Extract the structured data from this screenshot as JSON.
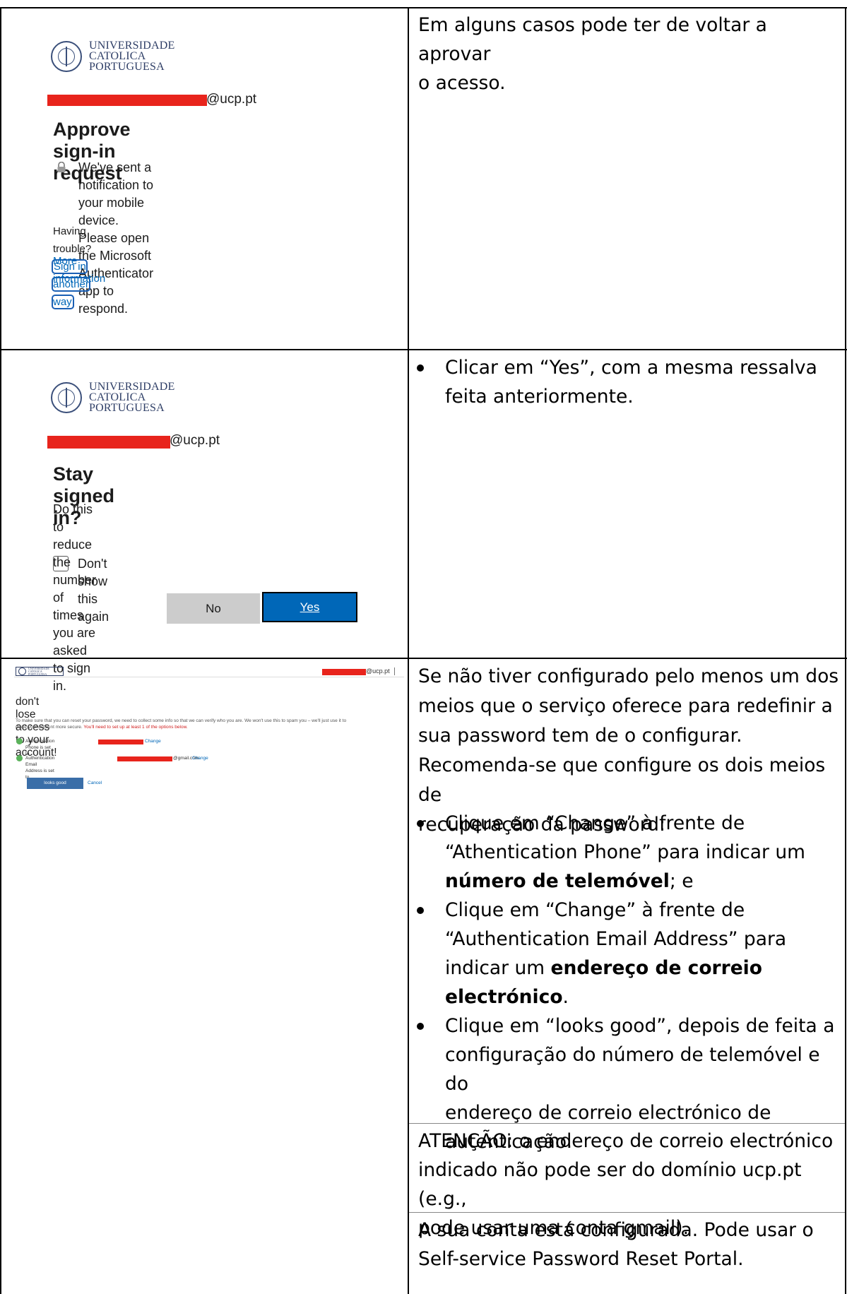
{
  "row1": {
    "shot": {
      "logo_lines": [
        "UNIVERSIDADE",
        "CATOLICA",
        "PORTUGUESA"
      ],
      "email_suffix": "@ucp.pt",
      "title": "Approve sign-in request",
      "message_lines": [
        "We've sent a notification to your mobile device.",
        "Please open the Microsoft Authenticator app to",
        "respond."
      ],
      "trouble_prefix": "Having trouble?",
      "trouble_link": "Sign in another way",
      "more_info": "More information"
    },
    "text_lines": [
      "Em alguns casos pode ter de voltar a aprovar",
      "o acesso."
    ]
  },
  "row2": {
    "shot": {
      "logo_lines": [
        "UNIVERSIDADE",
        "CATOLICA",
        "PORTUGUESA"
      ],
      "email_suffix": "@ucp.pt",
      "title": "Stay signed in?",
      "message_lines": [
        "Do this to reduce the number of times you are asked",
        "to sign in."
      ],
      "checkbox_label": "Don't show this again",
      "no_label": "No",
      "yes_label": "Yes"
    },
    "bullet_lines": [
      "Clicar em “Yes”, com a mesma ressalva",
      "feita anteriormente."
    ]
  },
  "row3": {
    "shot": {
      "logo_lines": [
        "UNIVERSIDADE",
        "CATOLICA",
        "PORTUGUESA"
      ],
      "header_email": "@ucp.pt",
      "title": "don't lose access to your account!",
      "desc_line1": "To make sure that you can reset your password, we need to collect some info so that we can verify who you are. We won't use this to spam you – we'll just use it to",
      "desc_line2_plain": "make your account more secure.",
      "desc_line2_red": "You'll need to set up at least 1 of the options below.",
      "phone_label": "Authentication Phone is set to",
      "email_label": "Authentication Email Address is set to",
      "email_suffix": "@gmail.com.",
      "change": "Change",
      "looks_good": "looks good",
      "cancel": "Cancel"
    },
    "intro_lines": [
      "Se não tiver configurado pelo menos um dos",
      "meios que o serviço oferece para redefinir a",
      "sua password tem de o configurar.",
      "Recomenda-se que configure os dois meios de",
      "recuperação da password:"
    ],
    "bullet1": {
      "l1": "Clique em “Change” à frente de",
      "l2": "“Athentication Phone” para indicar um",
      "l3_bold": "número de telemóvel",
      "l3_rest": "; e"
    },
    "bullet2": {
      "l1": "Clique em “Change” à frente de",
      "l2": "“Authentication Email Address” para",
      "l3_prefix": "indicar um ",
      "l3_bold": "endereço de correio",
      "l4_bold": "electrónico",
      "l4_rest": "."
    },
    "bullet3": [
      "Clique em “looks good”, depois de feita a",
      "configuração do número de telemóvel e do",
      "endereço de correio electrónico de",
      "autenticação."
    ],
    "warning_lines": [
      "ATENÇÃO: o endereço de correio electrónico",
      "indicado não pode ser do domínio ucp.pt (e.g.,",
      "pode usar uma conta gmail)."
    ],
    "final_lines": [
      "A sua conta está configurada. Pode usar o",
      "Self-service Password Reset Portal."
    ]
  }
}
